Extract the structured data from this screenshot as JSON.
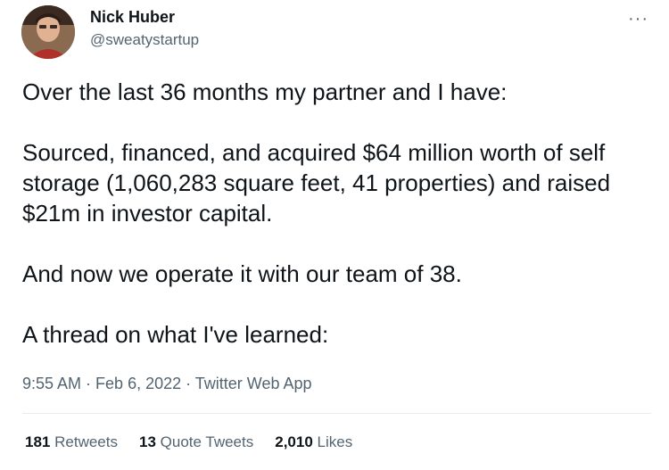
{
  "author": {
    "name": "Nick Huber",
    "handle": "@sweatystartup"
  },
  "more_icon": "more-horizontal-icon",
  "tweet": {
    "paragraphs": [
      "Over the last 36 months my partner and I have:",
      "Sourced, financed, and acquired $64 million worth of self storage (1,060,283 square feet, 41 properties) and raised $21m in investor capital.",
      "And now we operate it with our team of 38.",
      "A thread on what I've learned:"
    ]
  },
  "meta": {
    "time": "9:55 AM",
    "separator": " · ",
    "date": "Feb 6, 2022",
    "source": "Twitter Web App"
  },
  "stats": {
    "retweets": {
      "count": "181",
      "label": "Retweets"
    },
    "quotes": {
      "count": "13",
      "label": "Quote Tweets"
    },
    "likes": {
      "count": "2,010",
      "label": "Likes"
    }
  }
}
